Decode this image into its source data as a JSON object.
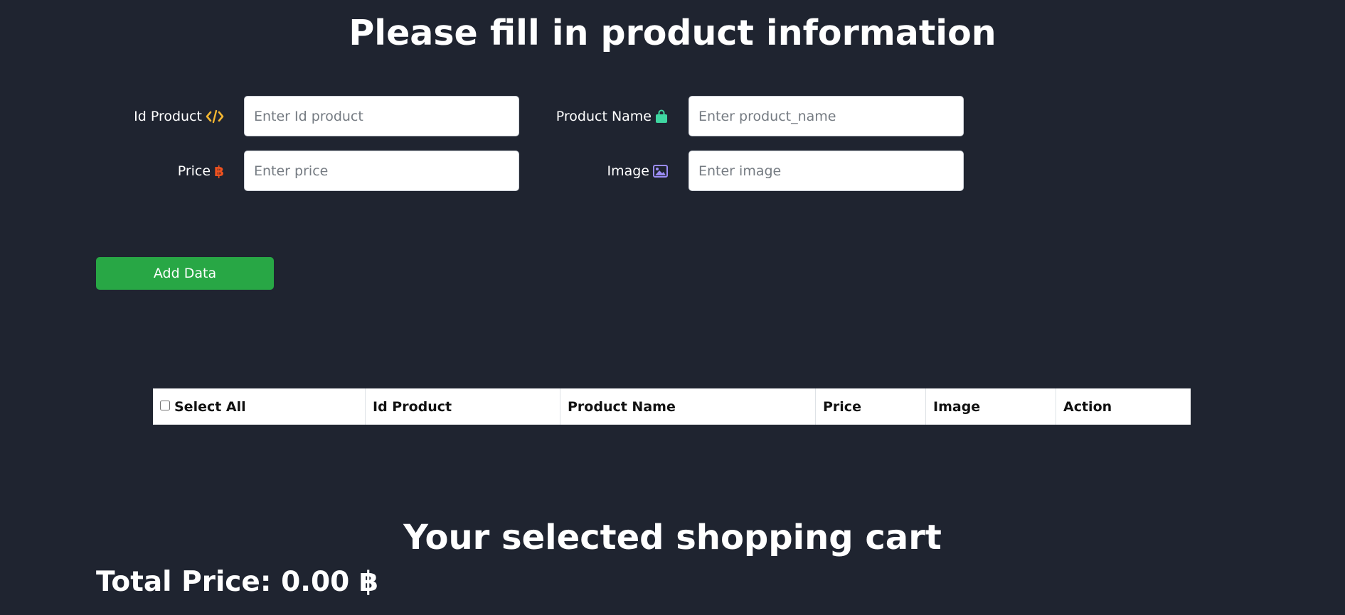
{
  "form": {
    "title": "Please fill in product information",
    "fields": {
      "id_product": {
        "label": "Id Product",
        "placeholder": "Enter Id product",
        "value": "",
        "icon": "code-icon",
        "icon_color": "#f2b632"
      },
      "product_name": {
        "label": "Product Name",
        "placeholder": "Enter product_name",
        "value": "",
        "icon": "shopping-bag-icon",
        "icon_color": "#3fd7a1"
      },
      "price": {
        "label": "Price",
        "placeholder": "Enter price",
        "value": "",
        "icon": "baht-icon",
        "icon_glyph": "฿",
        "icon_color": "#f0521f"
      },
      "image": {
        "label": "Image",
        "placeholder": "Enter image",
        "value": "",
        "icon": "image-icon",
        "icon_color": "#9b8cf5"
      }
    },
    "add_button_label": "Add Data",
    "add_button_color": "#28a745"
  },
  "table": {
    "headers": {
      "select_all": "Select All",
      "id_product": "Id Product",
      "product_name": "Product Name",
      "price": "Price",
      "image": "Image",
      "action": "Action"
    },
    "rows": []
  },
  "cart": {
    "title": "Your selected shopping cart",
    "total_label": "Total Price:",
    "total_value": "0.00",
    "currency": "฿"
  },
  "colors": {
    "background": "#1f2430",
    "text": "#ffffff"
  }
}
